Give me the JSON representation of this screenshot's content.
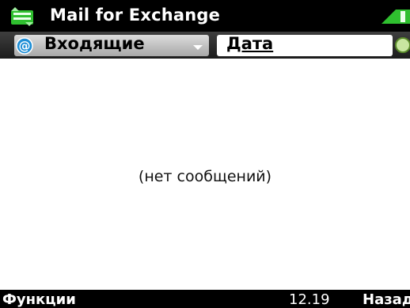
{
  "window": {
    "title": "Mail for Exchange"
  },
  "icons": {
    "app": "mail-for-exchange-icon",
    "battery": "battery-icon",
    "mailbox": "at-sign-icon",
    "sync": "sync-status-icon",
    "dropdown": "chevron-down-icon"
  },
  "toolbar": {
    "folder": "Входящие",
    "sort": "Дата"
  },
  "main": {
    "empty_message": "(нет сообщений)"
  },
  "softkeys": {
    "left": "Функции",
    "clock": "12.19",
    "right": "Назад"
  },
  "colors": {
    "accent_green": "#2fbf2f",
    "mailbox_blue": "#1f8fd6"
  }
}
